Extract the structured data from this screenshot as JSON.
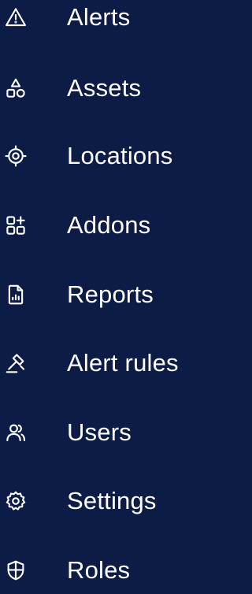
{
  "sidebar": {
    "background_color": "#0d1c47",
    "text_color": "#ffffff",
    "items": [
      {
        "label": "Alerts",
        "icon": "alert-triangle-icon"
      },
      {
        "label": "Assets",
        "icon": "shapes-icon"
      },
      {
        "label": "Locations",
        "icon": "target-icon"
      },
      {
        "label": "Addons",
        "icon": "grid-plus-icon"
      },
      {
        "label": "Reports",
        "icon": "report-chart-icon"
      },
      {
        "label": "Alert rules",
        "icon": "gavel-icon"
      },
      {
        "label": "Users",
        "icon": "users-icon"
      },
      {
        "label": "Settings",
        "icon": "gear-icon"
      },
      {
        "label": "Roles",
        "icon": "shield-icon"
      }
    ]
  }
}
